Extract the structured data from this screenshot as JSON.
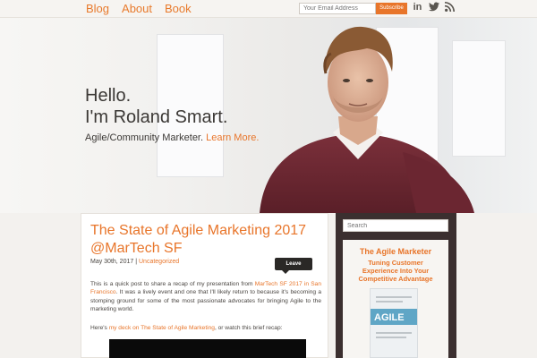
{
  "nav": {
    "items": [
      {
        "label": "Blog"
      },
      {
        "label": "About"
      },
      {
        "label": "Book"
      }
    ]
  },
  "subscribe": {
    "placeholder": "Your Email Address",
    "button_label": "Subscribe"
  },
  "social": {
    "icons": [
      "linkedin-icon",
      "twitter-icon",
      "rss-icon"
    ],
    "linkedin_glyph": "in",
    "twitter_glyph": "✦",
    "rss_glyph": "◔"
  },
  "hero": {
    "line1": "Hello.",
    "line2": "I'm Roland Smart.",
    "tagline": "Agile/Community Marketer.",
    "learn_more": "Learn More."
  },
  "post": {
    "title": "The State of Agile Marketing 2017 @MarTech SF",
    "date": "May 30th, 2017",
    "separator": "|",
    "category": "Uncategorized",
    "leave_comment": "Leave Comment",
    "body_pre": "This is a quick post to share a recap of my presentation from ",
    "body_link": "MarTech SF 2017 in San Francisco",
    "body_post": ". It was a lively event and one that I'll likely return to because it's becoming a stomping ground for some of the most passionate advocates for bringing Agile to the marketing world.",
    "deck_pre": "Here's ",
    "deck_link": "my deck on The State of Agile Marketing",
    "deck_post": ", or watch this brief recap:"
  },
  "sidebar": {
    "search_placeholder": "Search",
    "widget_title": "The Agile Marketer",
    "widget_subtitle_1": "Tuning Customer",
    "widget_subtitle_2": "Experience Into Your",
    "widget_subtitle_3": "Competitive Advantage",
    "book_word": "AGILE"
  },
  "colors": {
    "accent": "#e8752a",
    "sidebar_bg": "#3b2f2f",
    "text": "#3b3835"
  }
}
